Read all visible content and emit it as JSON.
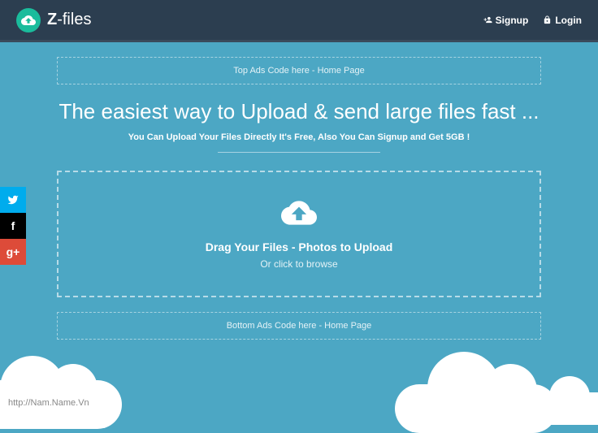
{
  "brand": {
    "prefix": "Z",
    "suffix": "-files"
  },
  "nav": {
    "signup": "Signup",
    "login": "Login"
  },
  "ads": {
    "top": "Top Ads Code here - Home Page",
    "bottom": "Bottom Ads Code here - Home Page"
  },
  "hero": {
    "title": "The easiest way to Upload & send large files fast ...",
    "subtitle": "You Can Upload Your Files Directly It's Free, Also You Can Signup and Get 5GB !"
  },
  "upload": {
    "title": "Drag Your Files - Photos to Upload",
    "subtitle": "Or click to browse"
  },
  "watermark": "http://Nam.Name.Vn"
}
